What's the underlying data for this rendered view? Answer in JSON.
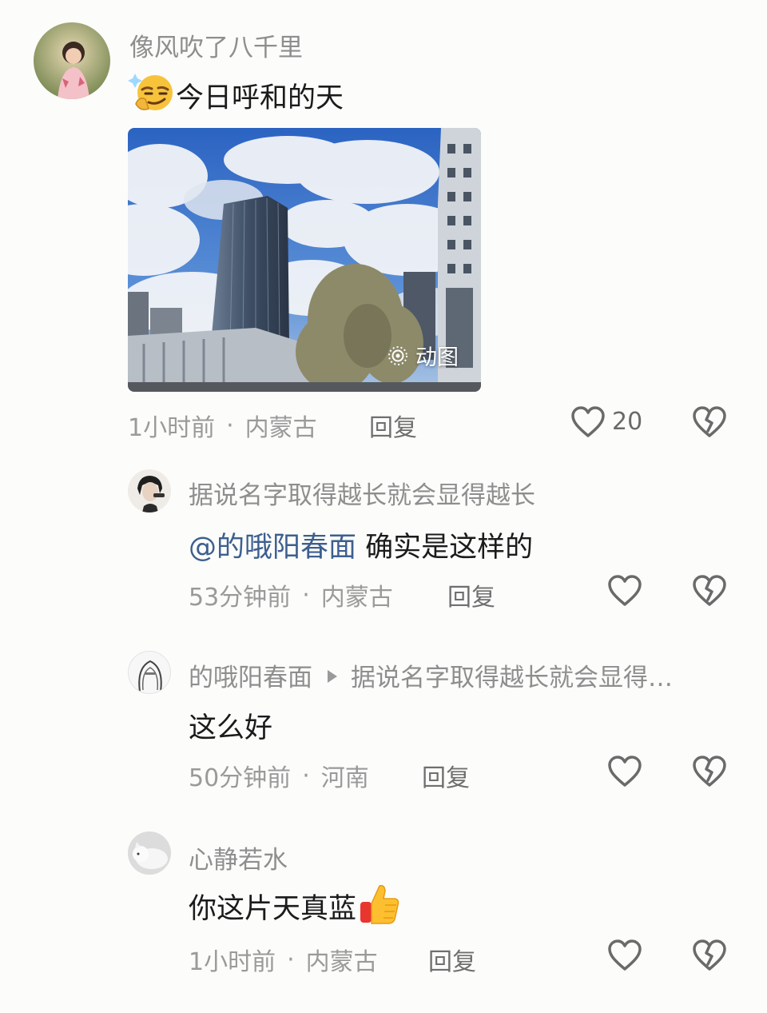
{
  "comments": [
    {
      "author": "像风吹了八千里",
      "emoji": "smirk-face",
      "text": "今日呼和的天",
      "media_badge": "动图",
      "time": "1小时前",
      "location": "内蒙古",
      "reply_label": "回复",
      "like_count": "20"
    }
  ],
  "replies": [
    {
      "author": "据说名字取得越长就会显得越长",
      "mention": "@的哦阳春面",
      "text": "确实是这样的",
      "time": "53分钟前",
      "location": "内蒙古",
      "reply_label": "回复"
    },
    {
      "author": "的哦阳春面",
      "reply_to": "据说名字取得越长就会显得…",
      "text": "这么好",
      "time": "50分钟前",
      "location": "河南",
      "reply_label": "回复"
    },
    {
      "author": "心静若水",
      "text": "你这片天真蓝",
      "emoji": "thumbs-up",
      "time": "1小时前",
      "location": "内蒙古",
      "reply_label": "回复"
    }
  ],
  "separator": "·",
  "colors": {
    "mention": "#3d5f8f",
    "meta_text": "#9a9a9a",
    "name_text": "#8e8e8e",
    "sky": "#3b74c9"
  }
}
